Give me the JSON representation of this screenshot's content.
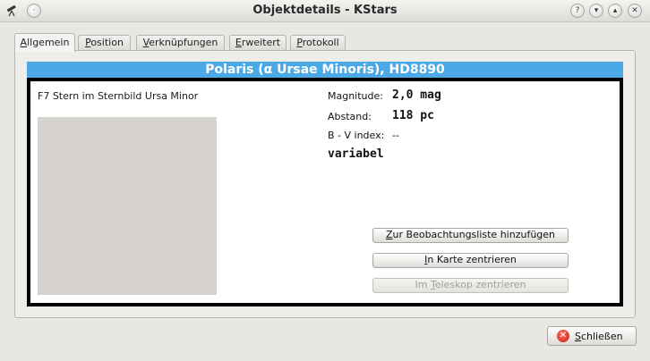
{
  "window": {
    "title": "Objektdetails - KStars",
    "controls": [
      "help-icon",
      "minimize-icon",
      "maximize-icon",
      "close-icon"
    ]
  },
  "tabs": [
    {
      "label": "Allgemein",
      "mnemonic": "A",
      "rest": "llgemein",
      "active": true
    },
    {
      "label": "Position",
      "mnemonic": "P",
      "rest": "osition",
      "active": false
    },
    {
      "label": "Verknüpfungen",
      "mnemonic": "V",
      "rest": "erknüpfungen",
      "active": false
    },
    {
      "label": "Erweitert",
      "mnemonic": "E",
      "rest": "rweitert",
      "active": false
    },
    {
      "label": "Protokoll",
      "mnemonic": "P",
      "rest": "rotokoll",
      "active": false
    }
  ],
  "object": {
    "name": "Polaris (α Ursae Minoris), HD8890",
    "type_line": "F7 Stern im Sternbild Ursa Minor",
    "magnitude_label": "Magnitude:",
    "magnitude_value": "2,0 mag",
    "distance_label": "Abstand:",
    "distance_value": "118 pc",
    "bv_label": "B - V index:",
    "bv_value": "--",
    "variability": "variabel"
  },
  "actions": {
    "add_observing_list": {
      "pre": "",
      "mn": "Z",
      "post": "ur Beobachtungsliste hinzufügen"
    },
    "center_map": {
      "pre": "",
      "mn": "I",
      "post": "n Karte zentrieren"
    },
    "center_telescope": {
      "pre": "Im ",
      "mn": "T",
      "post": "eleskop zentrieren"
    }
  },
  "footer": {
    "close": {
      "pre": "",
      "mn": "S",
      "post": "chließen"
    }
  },
  "colors": {
    "header_bg": "#4aa9e6",
    "accent_close": "#c8201a"
  }
}
